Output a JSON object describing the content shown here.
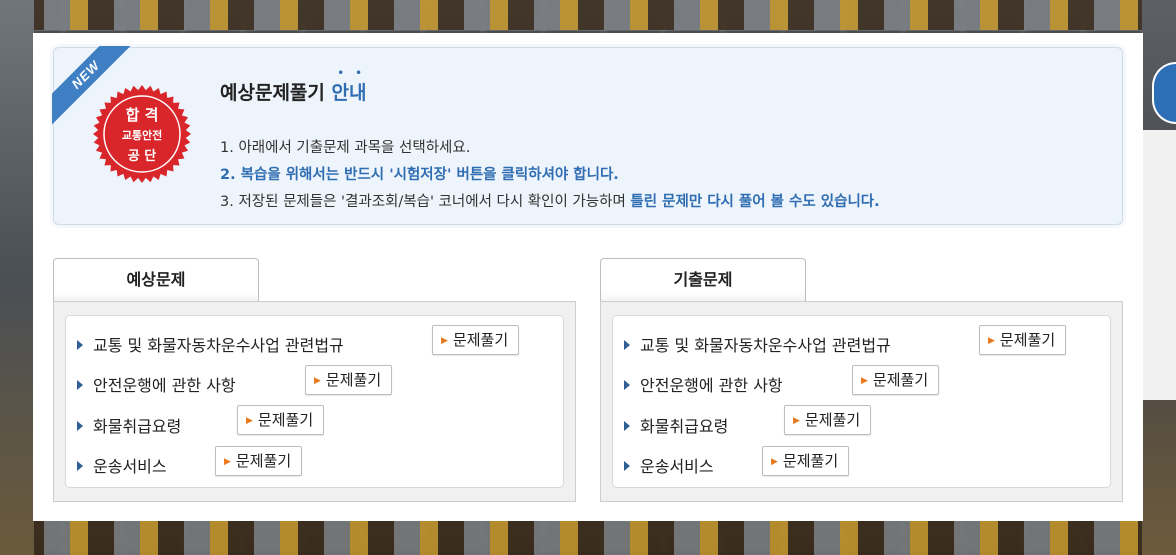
{
  "info": {
    "badge_new": "NEW",
    "seal_line1": "합 격",
    "seal_line2": "교통안전",
    "seal_line3": "공 단",
    "title_main": "예상문제풀기 ",
    "title_accent": "안내",
    "line1": "1. 아래에서 기출문제 과목을 선택하세요.",
    "line2": "2. 복습을 위해서는 반드시 '시험저장' 버튼을 클릭하셔야 합니다.",
    "line3_plain": "3. 저장된 문제들은 '결과조회/복습' 코너에서 다시 확인이 가능하며 ",
    "line3_bold": "틀린 문제만 다시 풀어 볼 수도 있습니다."
  },
  "left": {
    "tab_label": "예상문제",
    "items": [
      {
        "label": "교통 및 화물자동차운수사업 관련법규",
        "button": "문제풀기"
      },
      {
        "label": "안전운행에 관한 사항",
        "button": "문제풀기"
      },
      {
        "label": "화물취급요령",
        "button": "문제풀기"
      },
      {
        "label": "운송서비스",
        "button": "문제풀기"
      }
    ]
  },
  "right": {
    "tab_label": "기출문제",
    "items": [
      {
        "label": "교통 및 화물자동차운수사업 관련법규",
        "button": "문제풀기"
      },
      {
        "label": "안전운행에 관한 사항",
        "button": "문제풀기"
      },
      {
        "label": "화물취급요령",
        "button": "문제풀기"
      },
      {
        "label": "운송서비스",
        "button": "문제풀기"
      }
    ]
  },
  "colors": {
    "accent": "#2f6db3",
    "seal_red": "#d8262b",
    "arrow_orange": "#e8791d",
    "ribbon_blue": "#3f7fc4"
  }
}
